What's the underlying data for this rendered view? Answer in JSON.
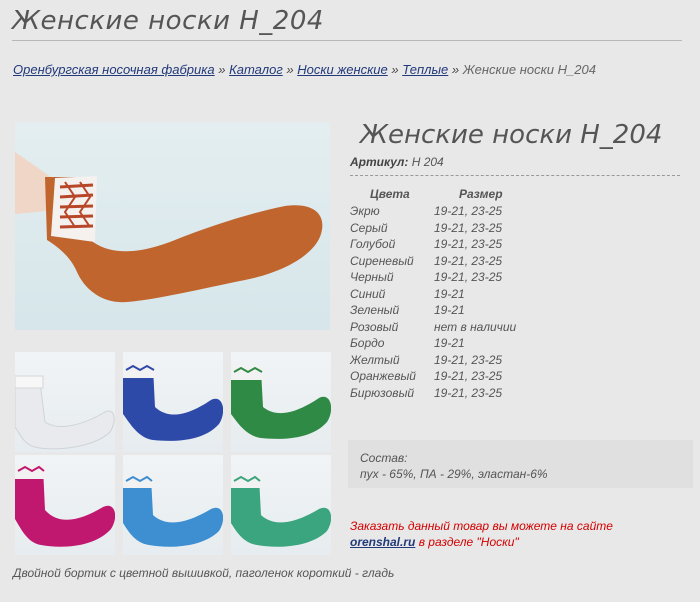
{
  "page_title": "Женские носки Н_204",
  "breadcrumb": {
    "items": [
      "Оренбургская носочная фабрика",
      "Каталог",
      "Носки женские",
      "Теплые"
    ],
    "separator": "»",
    "current": "Женские носки Н_204"
  },
  "product": {
    "title": "Женские носки Н_204",
    "article_label": "Артикул:",
    "article_value": "Н 204"
  },
  "table": {
    "headers": [
      "Цвета",
      "Размер"
    ],
    "rows": [
      [
        "Экрю",
        "19-21, 23-25"
      ],
      [
        "Серый",
        "19-21, 23-25"
      ],
      [
        "Голубой",
        "19-21, 23-25"
      ],
      [
        "Сиреневый",
        "19-21, 23-25"
      ],
      [
        "Черный",
        "19-21, 23-25"
      ],
      [
        "Синий",
        "19-21"
      ],
      [
        "Зеленый",
        "19-21"
      ],
      [
        "Розовый",
        "нет в наличии"
      ],
      [
        "Бордо",
        "19-21"
      ],
      [
        "Желтый",
        "19-21, 23-25"
      ],
      [
        "Оранжевый",
        "19-21, 23-25"
      ],
      [
        "Бирюзовый",
        "19-21, 23-25"
      ]
    ]
  },
  "composition": {
    "label": "Состав:",
    "value": "пух - 65%, ПА - 29%, эластан-6%"
  },
  "order": {
    "line1": "Заказать данный товар вы можете на сайте",
    "link": "orenshal.ru",
    "line2_suffix": "в разделе \"Носки\""
  },
  "caption": "Двойной бортик с цветной вышивкой, паголенок короткий - гладь",
  "colors": {
    "main_sock": "#c0652e",
    "thumbs": [
      "#e7e9ec",
      "#2e4aa8",
      "#2f8a45",
      "#c0186e",
      "#3d8fd1",
      "#3aa57e"
    ]
  }
}
